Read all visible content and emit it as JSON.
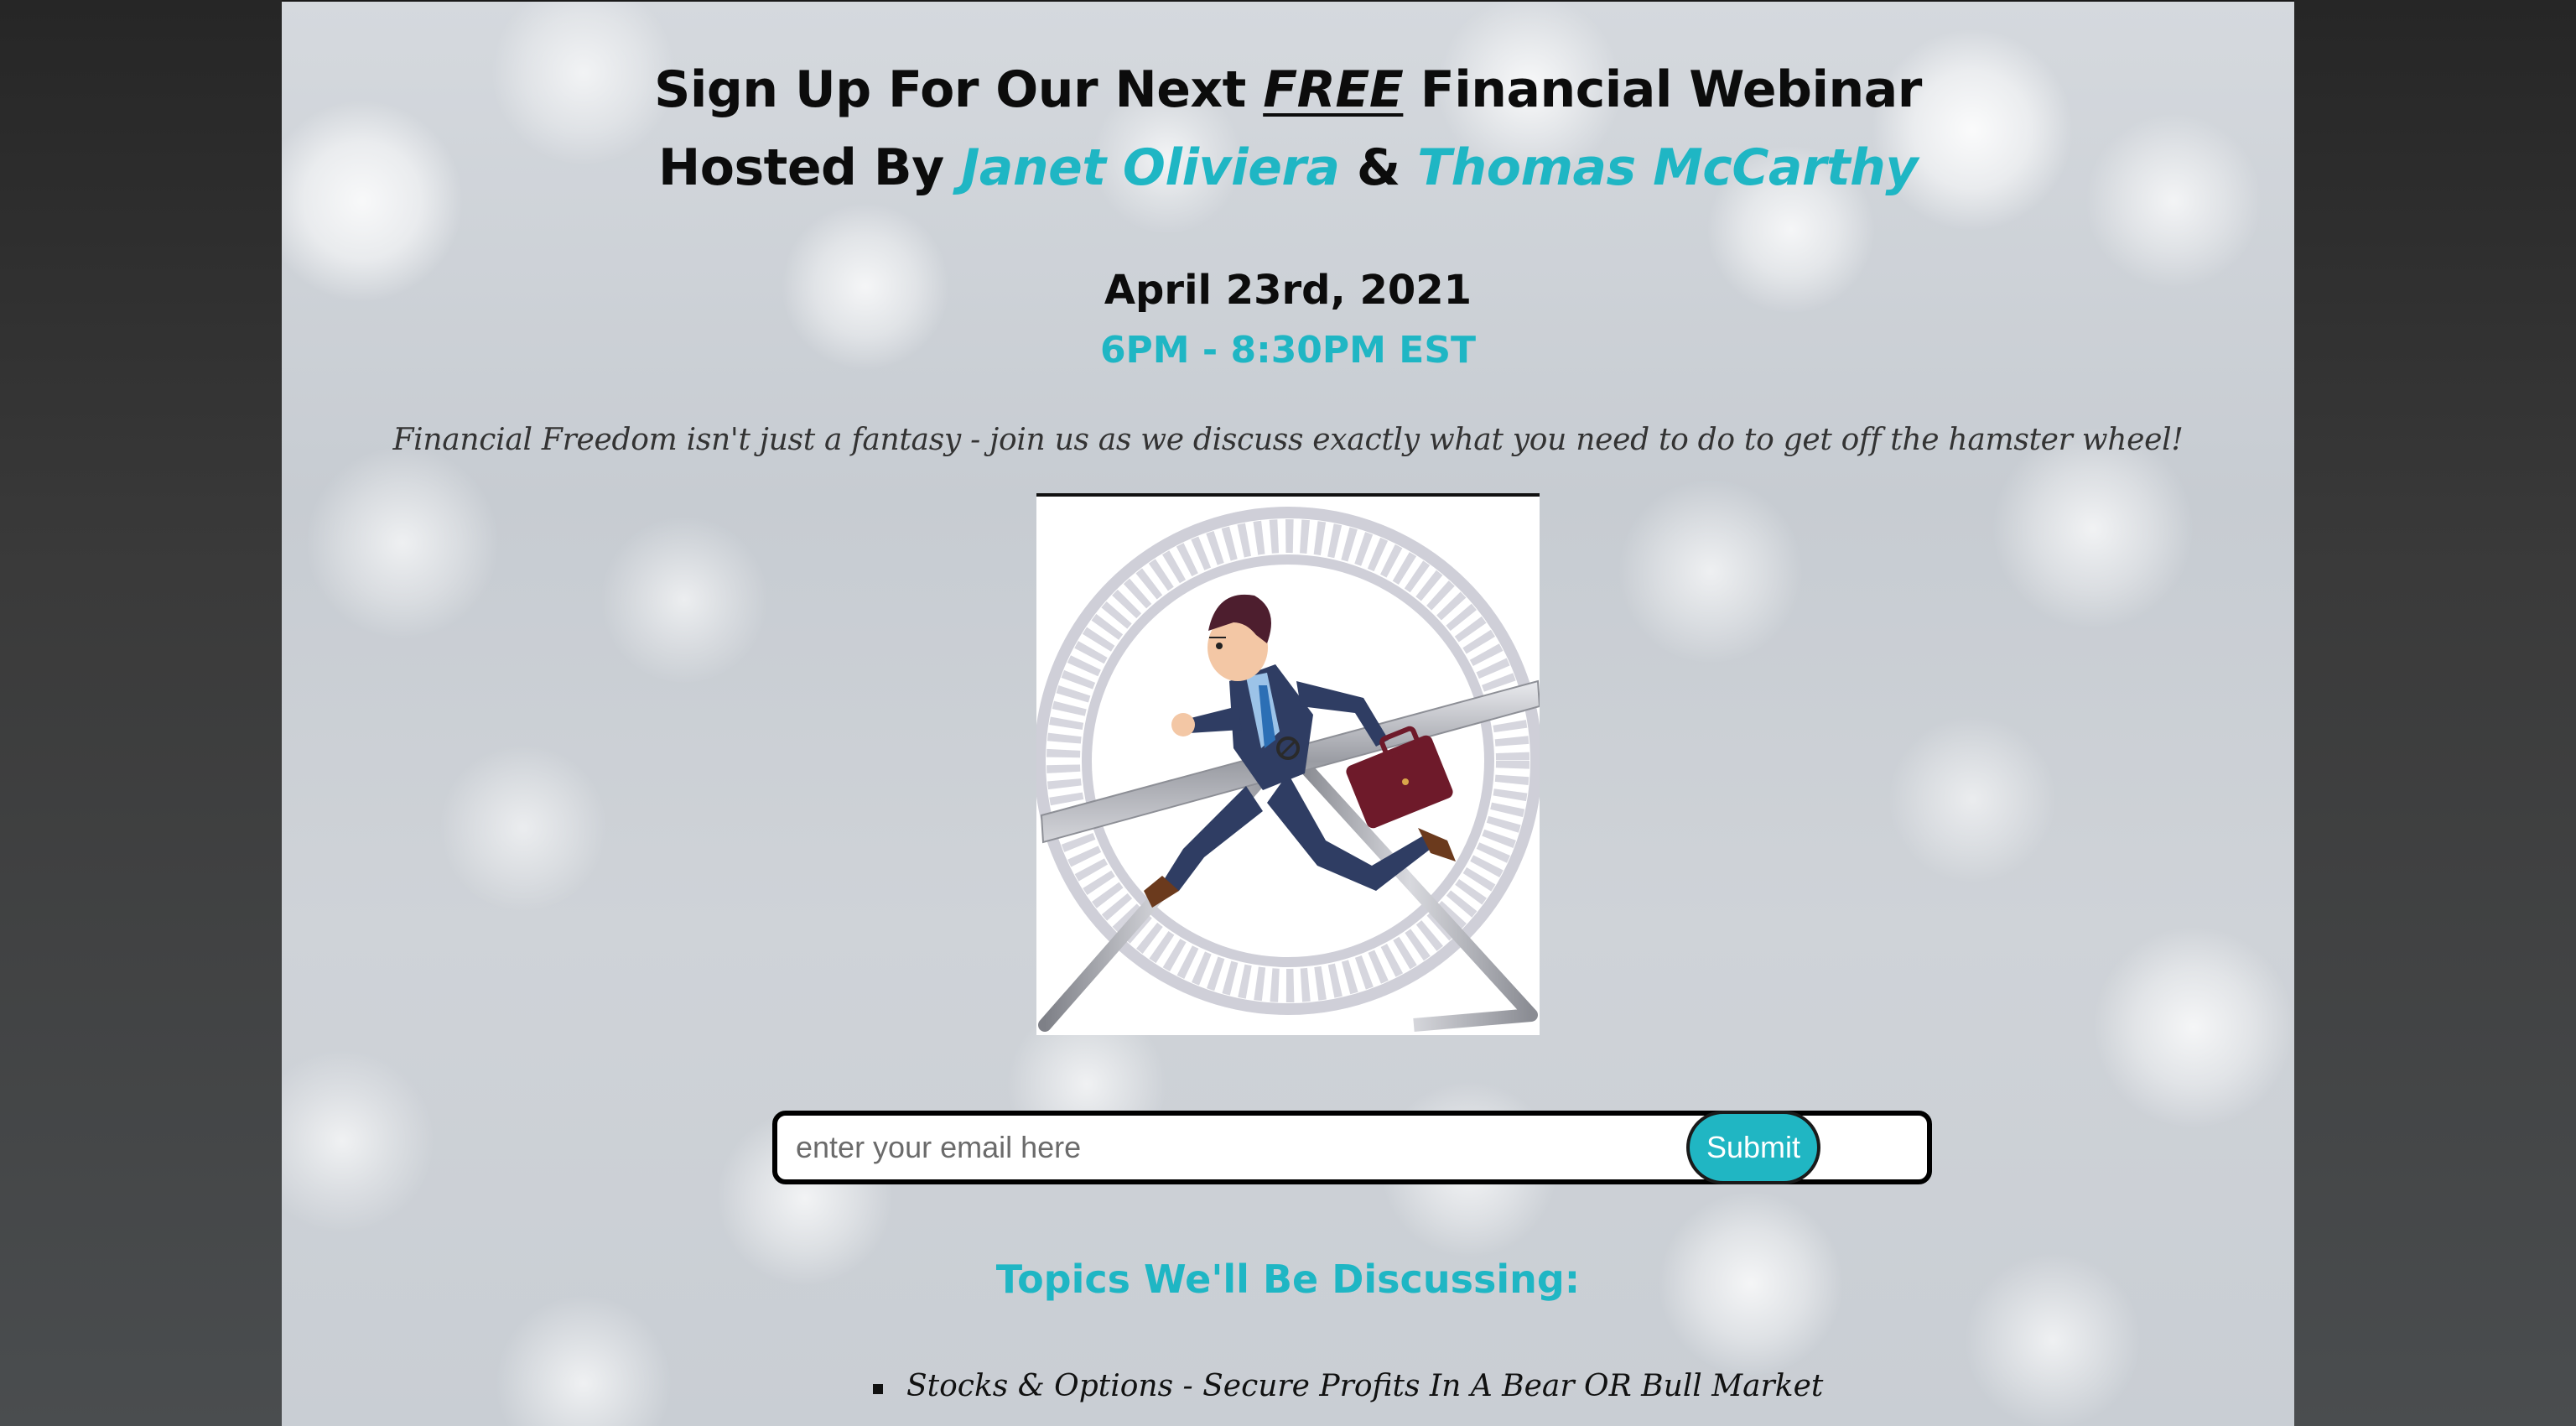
{
  "header": {
    "title_part1": "Sign Up For Our Next ",
    "title_emphasis": "FREE",
    "title_part2": " Financial Webinar",
    "hosted_by": "Hosted By ",
    "host_1": "Janet Oliviera",
    "joiner": " & ",
    "host_2": "Thomas McCarthy"
  },
  "event": {
    "date": "April 23rd, 2021",
    "time": "6PM - 8:30PM EST"
  },
  "tagline": "Financial Freedom isn't just a fantasy - join us as we discuss exactly what you need to do to get off the hamster wheel!",
  "signup": {
    "email_placeholder": "enter your email here",
    "email_value": "",
    "submit_label": "Submit"
  },
  "topics": {
    "heading": "Topics We'll Be Discussing:",
    "items": [
      "Stocks & Options - Secure Profits In A Bear OR Bull Market"
    ]
  },
  "colors": {
    "accent": "#1fb6c4",
    "text": "#0c0c0c",
    "outer_background": "#2e2e2e"
  },
  "icons": {
    "hero": "businessman-hamster-wheel-illustration",
    "list_bullet": "square-bullet"
  }
}
